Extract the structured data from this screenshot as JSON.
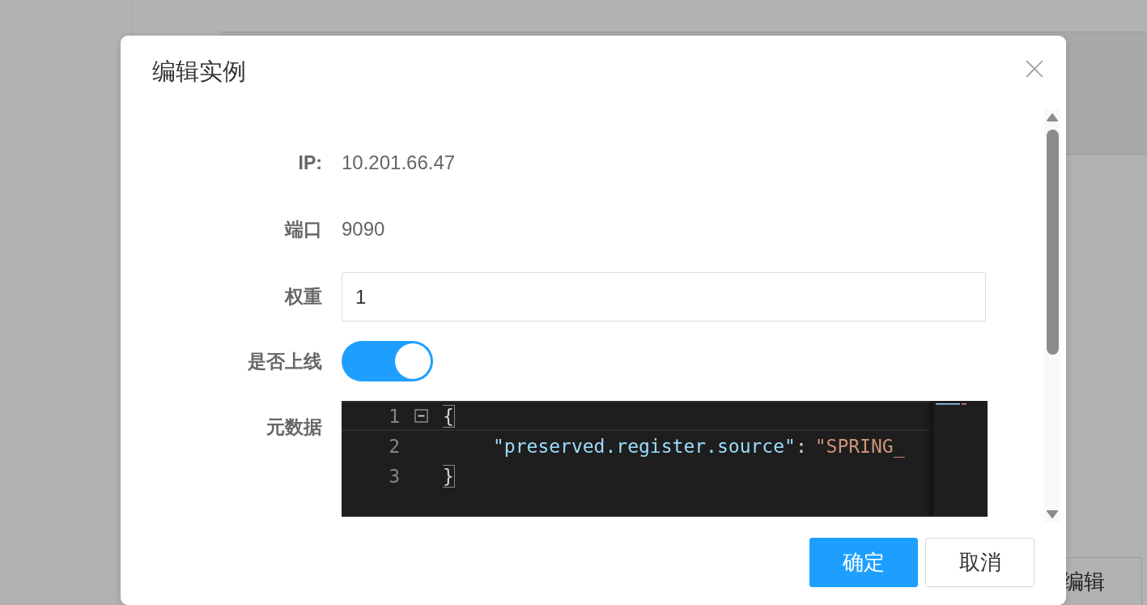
{
  "background": {
    "button": "编辑"
  },
  "dialog": {
    "title": "编辑实例",
    "rows": [
      {
        "kind": "text",
        "label": "IP:",
        "value": "10.201.66.47"
      },
      {
        "kind": "text",
        "label": "端口",
        "value": "9090"
      },
      {
        "kind": "input",
        "label": "权重",
        "value": "1"
      },
      {
        "kind": "switch",
        "label": "是否上线",
        "on": true
      },
      {
        "kind": "editor",
        "label": "元数据",
        "lines": [
          {
            "number": "1",
            "foldable": true,
            "current": true,
            "indented": false,
            "tokens": [
              {
                "kind": "bracket",
                "text": "{"
              }
            ]
          },
          {
            "number": "2",
            "foldable": false,
            "current": false,
            "indented": true,
            "tokens": [
              {
                "kind": "key",
                "text": "\"preserved.register.source\""
              },
              {
                "kind": "punct",
                "text": ":"
              },
              {
                "kind": "string",
                "text": "\"SPRING_"
              }
            ]
          },
          {
            "number": "3",
            "foldable": false,
            "current": false,
            "indented": false,
            "tokens": [
              {
                "kind": "bracket",
                "text": "}"
              }
            ]
          }
        ]
      }
    ],
    "buttons": [
      {
        "kind": "primary",
        "label": "确定"
      },
      {
        "kind": "default",
        "label": "取消"
      }
    ]
  }
}
